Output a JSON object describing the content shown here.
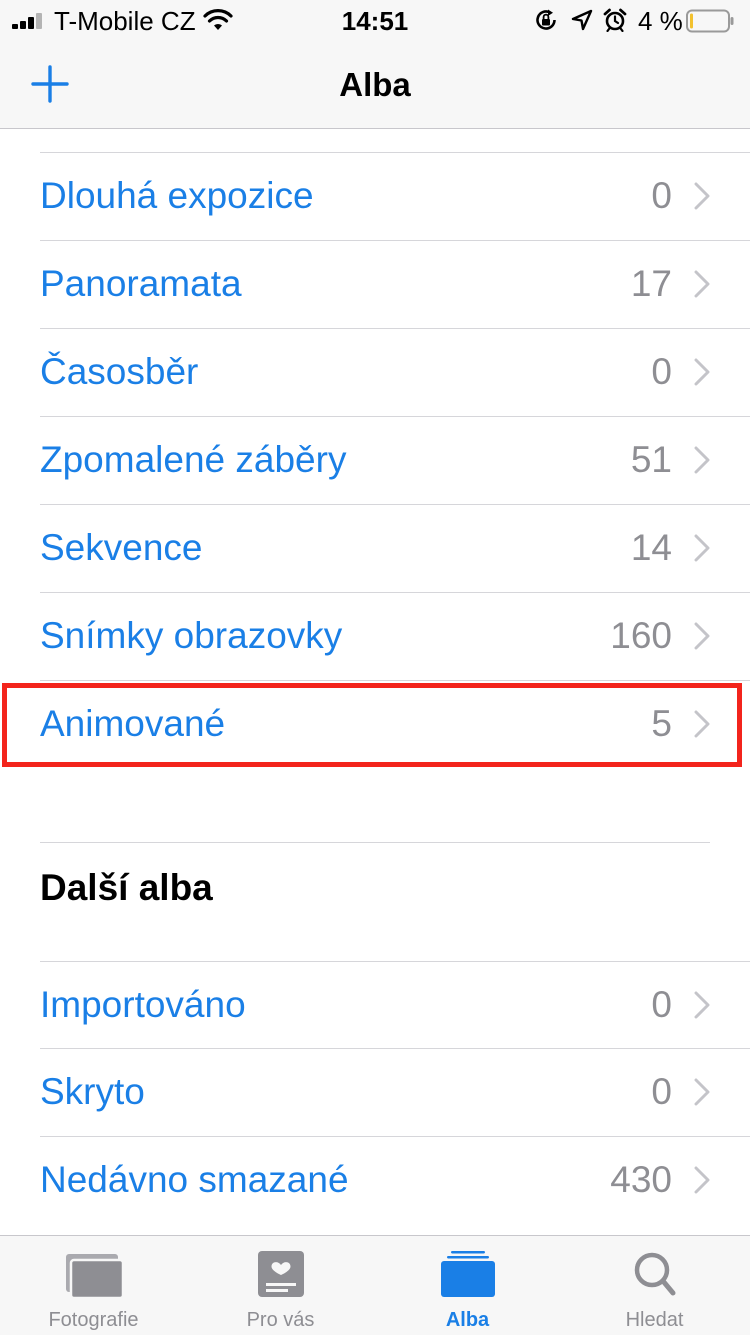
{
  "status_bar": {
    "carrier": "T-Mobile CZ",
    "time": "14:51",
    "battery_percent": "4 %",
    "signal_bars": 3,
    "battery_level": 0.04,
    "icons": [
      "wifi-icon",
      "orientation-lock-icon",
      "location-icon",
      "alarm-icon",
      "battery-icon"
    ]
  },
  "nav": {
    "title": "Alba",
    "add_icon": "plus-icon"
  },
  "media_types": [
    {
      "label": "Dlouhá expozice",
      "count": "0"
    },
    {
      "label": "Panoramata",
      "count": "17"
    },
    {
      "label": "Časosběr",
      "count": "0"
    },
    {
      "label": "Zpomalené záběry",
      "count": "51"
    },
    {
      "label": "Sekvence",
      "count": "14"
    },
    {
      "label": "Snímky obrazovky",
      "count": "160"
    },
    {
      "label": "Animované",
      "count": "5"
    }
  ],
  "other_albums": {
    "title": "Další alba",
    "items": [
      {
        "label": "Importováno",
        "count": "0"
      },
      {
        "label": "Skryto",
        "count": "0"
      },
      {
        "label": "Nedávno smazané",
        "count": "430"
      }
    ]
  },
  "tab_bar": {
    "tabs": [
      {
        "label": "Fotografie",
        "icon": "photos-icon"
      },
      {
        "label": "Pro vás",
        "icon": "for-you-icon"
      },
      {
        "label": "Alba",
        "icon": "albums-icon",
        "active": true
      },
      {
        "label": "Hledat",
        "icon": "search-icon"
      }
    ]
  },
  "colors": {
    "accent": "#1a7fe6",
    "highlight": "#f3241c",
    "secondary_text": "#8e8e93",
    "bar_background": "#f7f7f7"
  }
}
